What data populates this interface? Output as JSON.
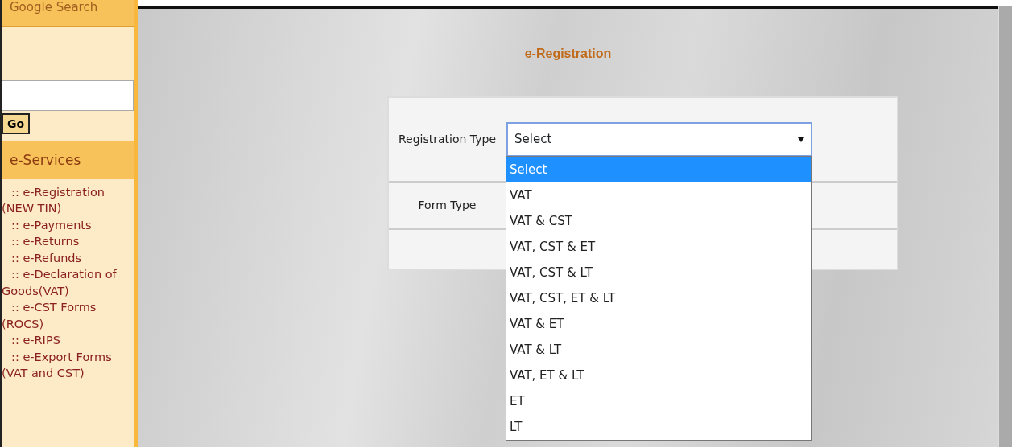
{
  "sidebar": {
    "search_heading": "Google Search",
    "go_button": "Go",
    "section_title": "e-Services",
    "items": [
      ":: e-Registration (NEW TIN)",
      ":: e-Payments",
      ":: e-Returns",
      ":: e-Refunds",
      ":: e-Declaration of Goods(VAT)",
      ":: e-CST Forms (ROCS)",
      ":: e-RIPS",
      ":: e-Export Forms (VAT and CST)"
    ]
  },
  "main": {
    "title": "e-Registration",
    "form_rows": [
      {
        "label": "Registration Type",
        "kind": "select",
        "value": "Select",
        "expanded": true
      },
      {
        "label": "Form Type",
        "kind": "blank"
      }
    ],
    "dropdown_options": [
      {
        "label": "Select",
        "selected": true
      },
      {
        "label": "VAT",
        "selected": false
      },
      {
        "label": "VAT & CST",
        "selected": false
      },
      {
        "label": "VAT, CST & ET",
        "selected": false
      },
      {
        "label": "VAT, CST & LT",
        "selected": false
      },
      {
        "label": "VAT, CST, ET & LT",
        "selected": false
      },
      {
        "label": "VAT & ET",
        "selected": false
      },
      {
        "label": "VAT & LT",
        "selected": false
      },
      {
        "label": "VAT, ET & LT",
        "selected": false
      },
      {
        "label": "ET",
        "selected": false
      },
      {
        "label": "LT",
        "selected": false
      }
    ]
  }
}
